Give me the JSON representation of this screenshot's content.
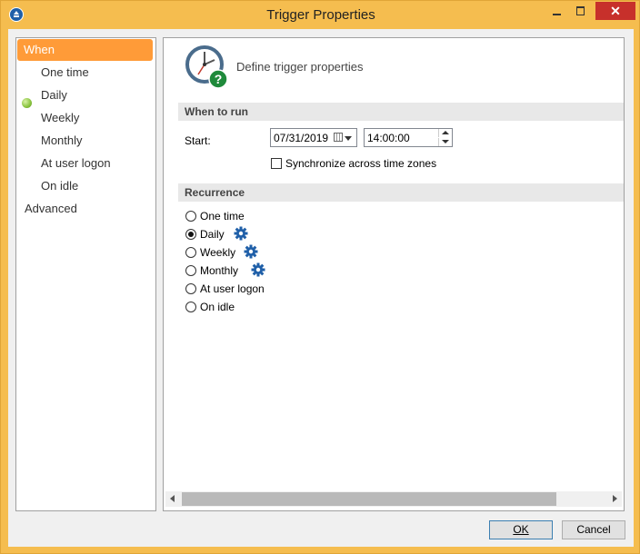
{
  "window": {
    "title": "Trigger Properties"
  },
  "nav": {
    "items": [
      {
        "label": "When",
        "selected": true
      },
      {
        "label": "One time"
      },
      {
        "label": "Daily",
        "indicator": "green-dot"
      },
      {
        "label": "Weekly"
      },
      {
        "label": "Monthly"
      },
      {
        "label": "At user logon"
      },
      {
        "label": "On idle"
      },
      {
        "label": "Advanced"
      }
    ]
  },
  "panel": {
    "heading": "Define trigger properties",
    "heading_icon": "clock-question-icon",
    "when_to_run": {
      "section_title": "When to run",
      "start_label": "Start:",
      "date_value": "07/31/2019",
      "time_value": "14:00:00",
      "sync_label": "Synchronize across time zones",
      "sync_checked": false
    },
    "recurrence": {
      "section_title": "Recurrence",
      "options": [
        {
          "label": "One time",
          "checked": false,
          "has_settings": false
        },
        {
          "label": "Daily",
          "checked": true,
          "has_settings": true
        },
        {
          "label": "Weekly",
          "checked": false,
          "has_settings": true
        },
        {
          "label": "Monthly",
          "checked": false,
          "has_settings": true
        },
        {
          "label": "At user logon",
          "checked": false,
          "has_settings": false
        },
        {
          "label": "On idle",
          "checked": false,
          "has_settings": false
        }
      ]
    }
  },
  "footer": {
    "ok_label": "OK",
    "cancel_label": "Cancel"
  },
  "colors": {
    "frame": "#f5bd4f",
    "nav_selected": "#ff9b38",
    "section_bg": "#e8e8e8",
    "gear": "#1f5fa8",
    "close_button": "#c7302b"
  }
}
